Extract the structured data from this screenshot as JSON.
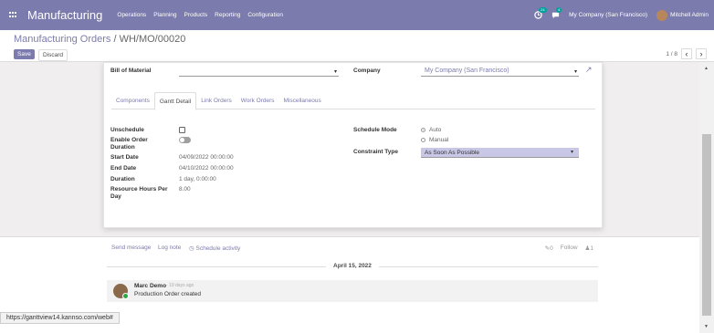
{
  "navbar": {
    "app_name": "Manufacturing",
    "menus": [
      "Operations",
      "Planning",
      "Products",
      "Reporting",
      "Configuration"
    ],
    "activity_badge": "24",
    "message_badge": "4",
    "company": "My Company (San Francisco)",
    "user": "Mitchell Admin"
  },
  "control_panel": {
    "breadcrumb_parent": "Manufacturing Orders",
    "breadcrumb_sep": "/",
    "breadcrumb_current": "WH/MO/00020",
    "save_label": "Save",
    "discard_label": "Discard",
    "pager_value": "1 / 8"
  },
  "form": {
    "bill_of_material_label": "Bill of Material",
    "bill_of_material_value": "",
    "company_label": "Company",
    "company_value": "My Company (San Francisco)",
    "tabs": [
      "Components",
      "Gantt Detail",
      "Link Orders",
      "Work Orders",
      "Miscellaneous"
    ],
    "active_tab": "Gantt Detail",
    "unschedule_label": "Unschedule",
    "unschedule_checked": false,
    "enable_order_duration_label": "Enable Order Duration",
    "enable_order_duration_on": false,
    "start_date_label": "Start Date",
    "start_date_value": "04/09/2022 00:00:00",
    "end_date_label": "End Date",
    "end_date_value": "04/10/2022 00:00:00",
    "duration_label": "Duration",
    "duration_value": "1 day, 0:00:00",
    "resource_hours_label": "Resource Hours Per Day",
    "resource_hours_value": "8.00",
    "schedule_mode_label": "Schedule Mode",
    "schedule_mode_options": [
      "Auto",
      "Manual"
    ],
    "schedule_mode_selected": "Auto",
    "constraint_type_label": "Constraint Type",
    "constraint_type_value": "As Soon As Possible"
  },
  "chatter": {
    "send_message": "Send message",
    "log_note": "Log note",
    "schedule_activity": "Schedule activity",
    "attachments_count": "0",
    "follow_label": "Follow",
    "followers_count": "1",
    "date_separator": "April 15, 2022",
    "message_author": "Marc Demo",
    "message_time": "- 19 days ago",
    "message_body": "Production Order created"
  },
  "status_url": "https://ganttview14.kannso.com/web#",
  "colors": {
    "brand": "#7c7bad",
    "select_highlight": "#c8c7e6",
    "background": "#f0eeee"
  }
}
